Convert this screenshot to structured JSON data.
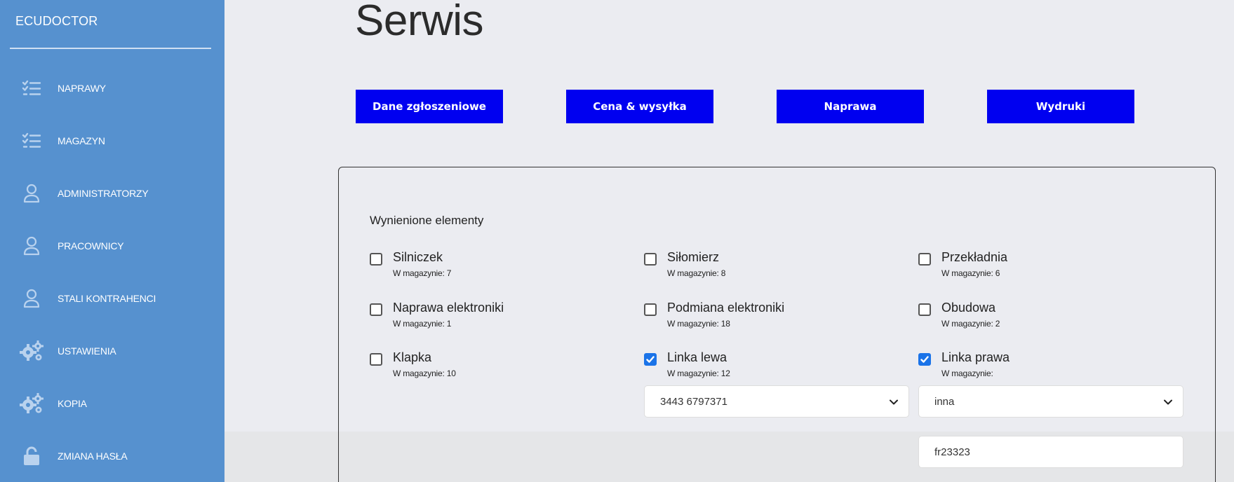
{
  "sidebar": {
    "brand": "ECUDOCTOR",
    "items": [
      {
        "label": "NAPRAWY",
        "icon": "checklist-icon"
      },
      {
        "label": "MAGAZYN",
        "icon": "checklist-icon"
      },
      {
        "label": "ADMINISTRATORZY",
        "icon": "user-icon"
      },
      {
        "label": "PRACOWNICY",
        "icon": "user-icon"
      },
      {
        "label": "STALI KONTRAHENCI",
        "icon": "user-icon"
      },
      {
        "label": "USTAWIENIA",
        "icon": "gears-icon"
      },
      {
        "label": "KOPIA",
        "icon": "gears-icon"
      },
      {
        "label": "ZMIANA HASŁA",
        "icon": "unlock-icon"
      }
    ]
  },
  "main": {
    "title": "Serwis",
    "tabs": [
      {
        "label": "Dane zgłoszeniowe"
      },
      {
        "label": "Cena & wysyłka"
      },
      {
        "label": "Naprawa"
      },
      {
        "label": "Wydruki"
      }
    ],
    "panel": {
      "title": "Wynienione elementy",
      "items": [
        {
          "name": "Silniczek",
          "stock": "W magazynie: 7",
          "checked": false
        },
        {
          "name": "Siłomierz",
          "stock": "W magazynie: 8",
          "checked": false
        },
        {
          "name": "Przekładnia",
          "stock": "W magazynie: 6",
          "checked": false
        },
        {
          "name": "Naprawa elektroniki",
          "stock": "W magazynie: 1",
          "checked": false
        },
        {
          "name": "Podmiana elektroniki",
          "stock": "W magazynie: 18",
          "checked": false
        },
        {
          "name": "Obudowa",
          "stock": "W magazynie: 2",
          "checked": false
        },
        {
          "name": "Klapka",
          "stock": "W magazynie: 10",
          "checked": false
        },
        {
          "name": "Linka lewa",
          "stock": "W magazynie: 12",
          "checked": true
        },
        {
          "name": "Linka prawa",
          "stock": "W magazynie:",
          "checked": true
        }
      ],
      "linka_lewa_select": "3443 6797371",
      "linka_prawa_select": "inna",
      "linka_prawa_input": "fr23323"
    }
  },
  "colors": {
    "sidebar": "#5691cf",
    "tab_button": "#0000f0",
    "checkbox_checked": "#1a73e8"
  }
}
